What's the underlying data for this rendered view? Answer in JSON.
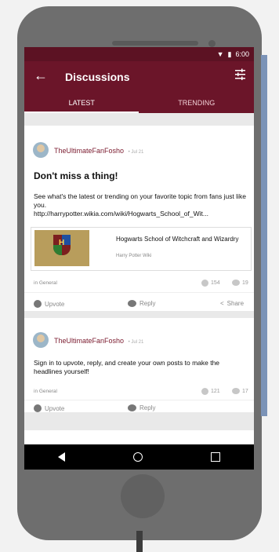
{
  "status": {
    "time": "6:00"
  },
  "toolbar": {
    "title": "Discussions"
  },
  "tabs": [
    {
      "label": "LATEST",
      "active": true
    },
    {
      "label": "TRENDING",
      "active": false
    }
  ],
  "posts": [
    {
      "user": "TheUltimateFanFosho",
      "date": "Jul 21",
      "title": "Don't miss a thing!",
      "body_line1": "See what's the latest or trending on your favorite topic from fans just like you.",
      "body_line2": "http://harrypotter.wikia.com/wiki/Hogwarts_School_of_Wit...",
      "preview": {
        "title": "Hogwarts School of Witchcraft and Wizardry",
        "site": "Harry Potter Wiki"
      },
      "category": "in General",
      "upvotes": "154",
      "replies": "19",
      "actions": {
        "upvote": "Upvote",
        "reply": "Reply",
        "share": "Share"
      }
    },
    {
      "user": "TheUltimateFanFosho",
      "date": "Jul 21",
      "body": "Sign in to upvote, reply, and create your own posts to make the headlines yourself!",
      "category": "in General",
      "upvotes": "121",
      "replies": "17",
      "actions": {
        "upvote": "Upvote",
        "reply": "Reply"
      }
    }
  ],
  "fab": {
    "label": "+"
  },
  "colors": {
    "primary": "#6b1529",
    "status": "#5c1223",
    "fab": "#7b1a33"
  }
}
